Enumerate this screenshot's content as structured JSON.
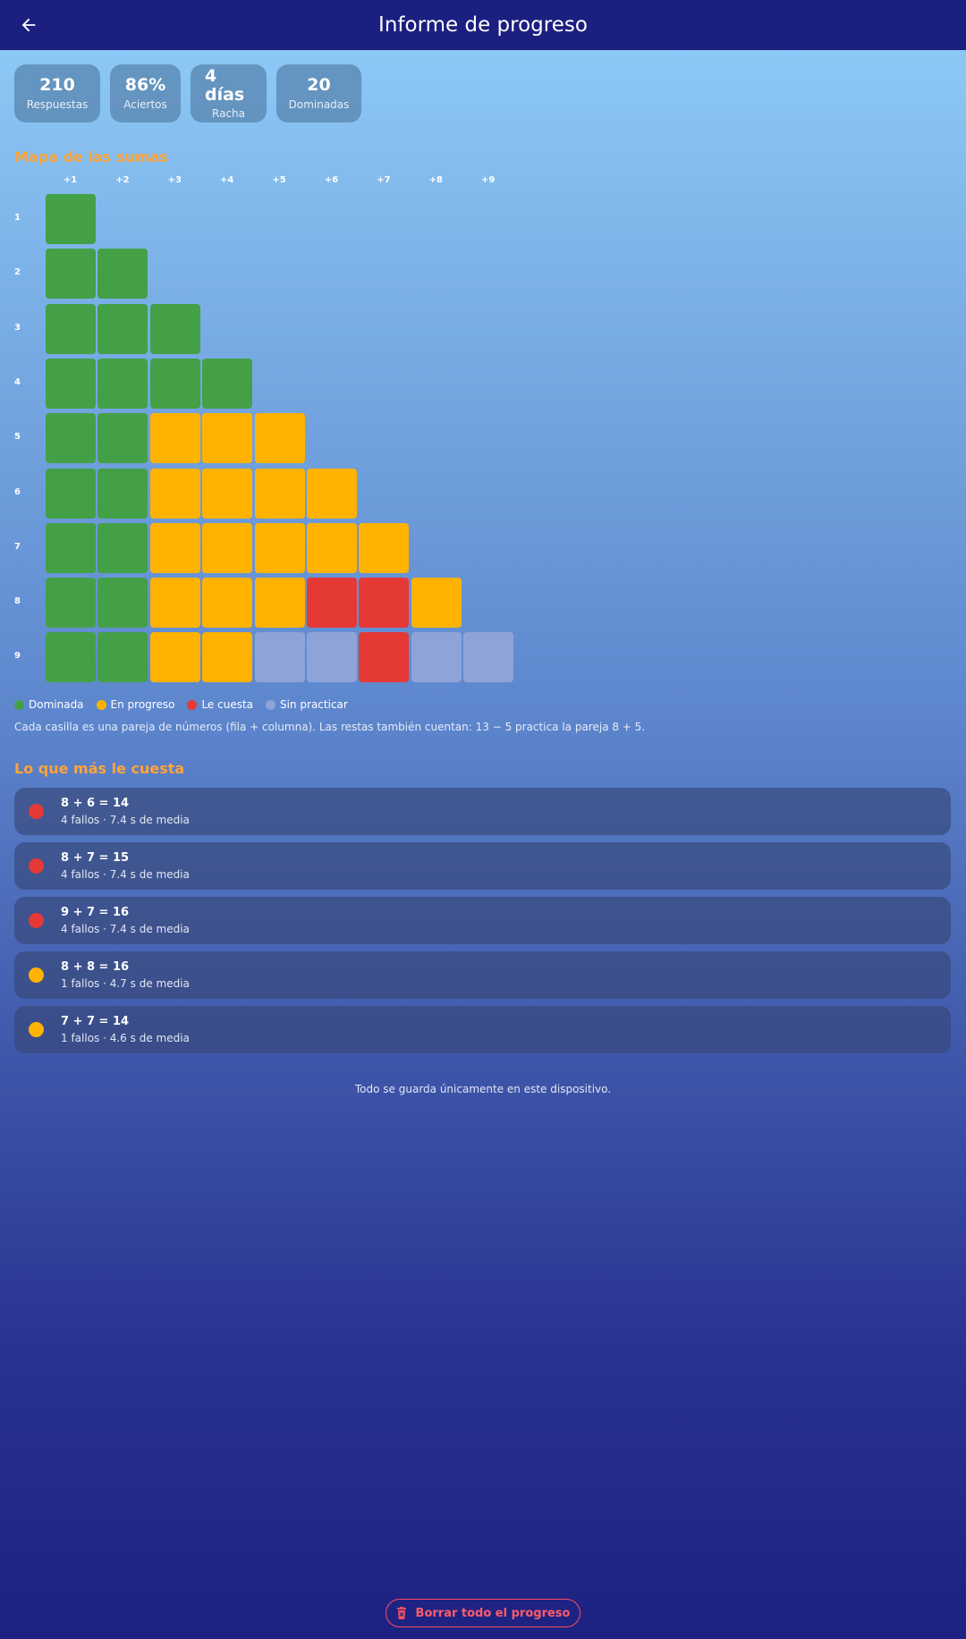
{
  "header": {
    "title": "Informe de progreso",
    "back_icon": "arrow-left-icon"
  },
  "stats": [
    {
      "value": "210",
      "label": "Respuestas"
    },
    {
      "value": "86%",
      "label": "Aciertos"
    },
    {
      "value": "4 días",
      "label": "Racha"
    },
    {
      "value": "20",
      "label": "Dominadas"
    }
  ],
  "map": {
    "title": "Mapa de las sumas",
    "columns": [
      "+1",
      "+2",
      "+3",
      "+4",
      "+5",
      "+6",
      "+7",
      "+8",
      "+9"
    ],
    "rows": [
      "1",
      "2",
      "3",
      "4",
      "5",
      "6",
      "7",
      "8",
      "9"
    ],
    "status_colors": {
      "dominada": "#43a047",
      "progreso": "#ffb300",
      "cuesta": "#e53935",
      "sin": "#8ea4d8"
    },
    "cells": [
      [
        "dominada"
      ],
      [
        "dominada",
        "dominada"
      ],
      [
        "dominada",
        "dominada",
        "dominada"
      ],
      [
        "dominada",
        "dominada",
        "dominada",
        "dominada"
      ],
      [
        "dominada",
        "dominada",
        "progreso",
        "progreso",
        "progreso"
      ],
      [
        "dominada",
        "dominada",
        "progreso",
        "progreso",
        "progreso",
        "progreso"
      ],
      [
        "dominada",
        "dominada",
        "progreso",
        "progreso",
        "progreso",
        "progreso",
        "progreso"
      ],
      [
        "dominada",
        "dominada",
        "progreso",
        "progreso",
        "progreso",
        "cuesta",
        "cuesta",
        "progreso"
      ],
      [
        "dominada",
        "dominada",
        "progreso",
        "progreso",
        "sin",
        "sin",
        "cuesta",
        "sin",
        "sin"
      ]
    ]
  },
  "legend": [
    {
      "label": "Dominada",
      "color": "#43a047"
    },
    {
      "label": "En progreso",
      "color": "#ffb300"
    },
    {
      "label": "Le cuesta",
      "color": "#e53935"
    },
    {
      "label": "Sin practicar",
      "color": "#8ea4d8"
    }
  ],
  "note": "Cada casilla es una pareja de números (fila + columna). Las restas también cuentan: 13 − 5 practica la pareja 8 + 5.",
  "difficult": {
    "title": "Lo que más le cuesta",
    "items": [
      {
        "equation": "8 + 6 = 14",
        "detail": "4 fallos · 7.4 s de media",
        "color": "#e53935"
      },
      {
        "equation": "8 + 7 = 15",
        "detail": "4 fallos · 7.4 s de media",
        "color": "#e53935"
      },
      {
        "equation": "9 + 7 = 16",
        "detail": "4 fallos · 7.4 s de media",
        "color": "#e53935"
      },
      {
        "equation": "8 + 8 = 16",
        "detail": "1 fallos · 4.7 s de media",
        "color": "#ffb300"
      },
      {
        "equation": "7 + 7 = 14",
        "detail": "1 fallos · 4.6 s de media",
        "color": "#ffb300"
      }
    ]
  },
  "footer_note": "Todo se guarda únicamente en este dispositivo.",
  "reset": {
    "label": "Borrar todo el progreso",
    "icon": "trash-icon",
    "color": "#ff4d5e"
  }
}
